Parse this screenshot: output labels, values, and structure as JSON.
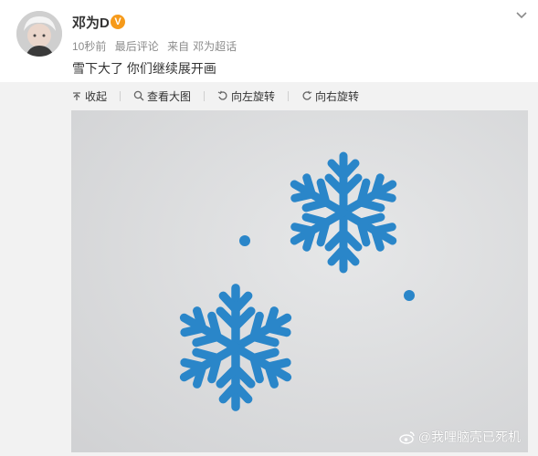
{
  "post": {
    "username": "邓为D",
    "verified_badge_icon": "verified-v-icon",
    "time": "10秒前",
    "comment_sort": "最后评论",
    "source_prefix": "来自",
    "source_name": "邓为超话",
    "text": "雪下大了 你们继续展开画"
  },
  "toolbar": {
    "collapse_label": "收起",
    "view_large_label": "查看大图",
    "rotate_left_label": "向左旋转",
    "rotate_right_label": "向右旋转"
  },
  "image": {
    "watermark": "@我哩脑壳已死机",
    "colors": {
      "paper": "#dddedf",
      "snowflake": "#2a86c9"
    }
  },
  "icons": {
    "menu": "chevron-down-icon",
    "collapse": "collapse-up-icon",
    "view_large": "magnifier-icon",
    "rotate_left": "rotate-left-icon",
    "rotate_right": "rotate-right-icon",
    "watermark": "weibo-logo-icon"
  }
}
